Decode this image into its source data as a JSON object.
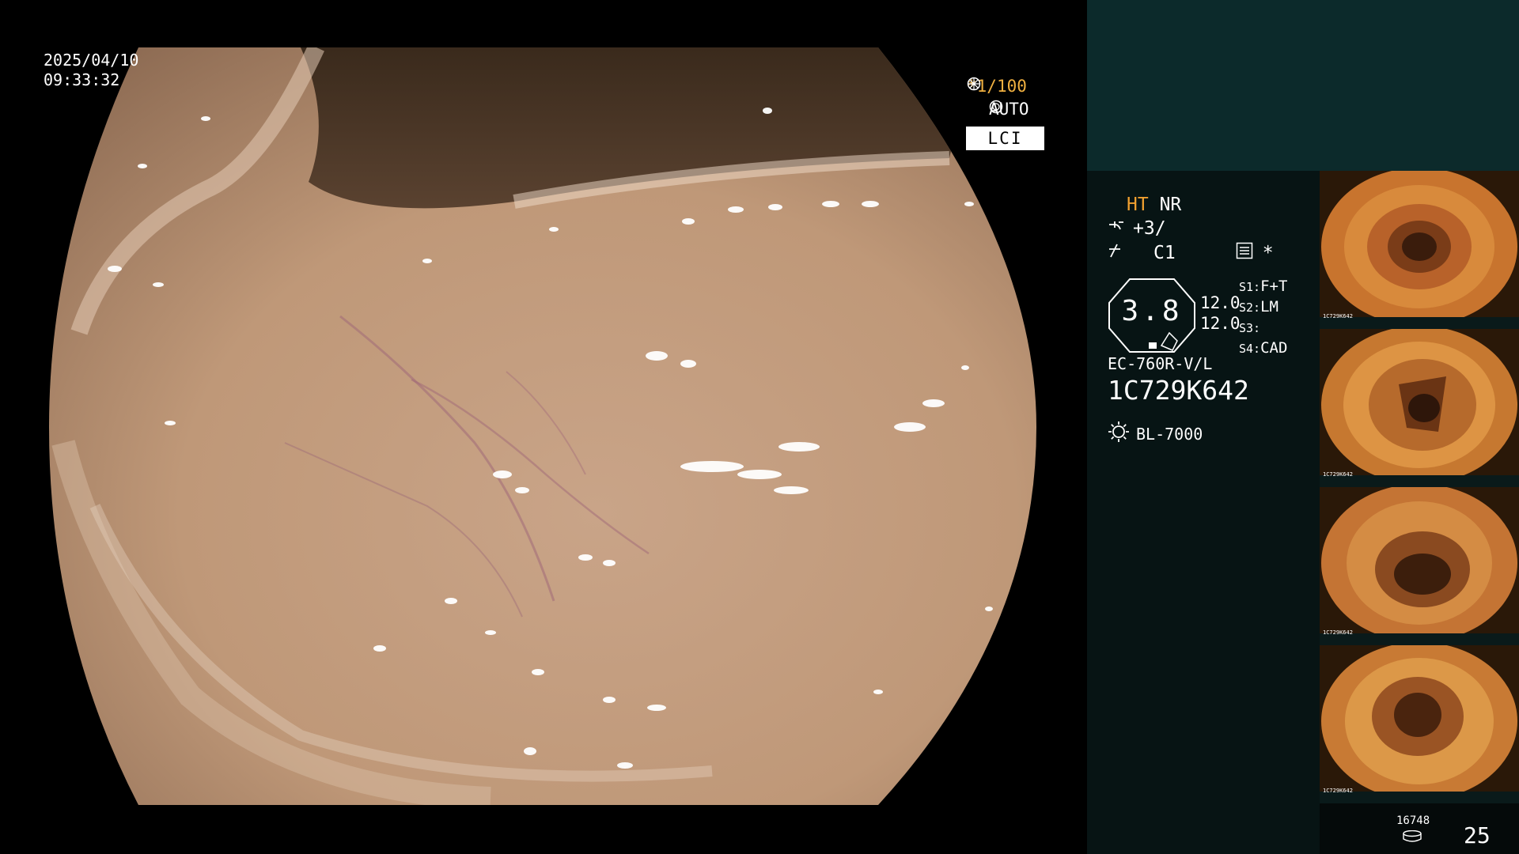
{
  "overlay": {
    "date": "2025/04/10",
    "time": "09:33:32",
    "shutter_star": "*",
    "shutter": "1/100",
    "auto": "AUTO",
    "mode": "LCI",
    "shutter_color": "#f0b040"
  },
  "panel": {
    "ht": "HT",
    "nr": "NR",
    "ht_color": "#f0a030",
    "enhance": "+3/",
    "color_mode": "C1",
    "star": "*",
    "zoom": "3.8",
    "val1": "12.0",
    "val2": "12.0",
    "s1_label": "S1:",
    "s1_value": "F+T",
    "s2_label": "S2:",
    "s2_value": "LM",
    "s3_label": "S3:",
    "s3_value": "",
    "s4_label": "S4:",
    "s4_value": "CAD",
    "scope_model": "EC-760R-V/L",
    "scope_serial": "1C729K642",
    "light_source": "BL-7000",
    "icons": [
      "enhance-icon",
      "color-icon",
      "menu-icon",
      "light-icon",
      "disk-icon"
    ]
  },
  "thumbnails": [
    {
      "id": "thumb-1",
      "serial": "1C729K642"
    },
    {
      "id": "thumb-2",
      "serial": "1C729K642"
    },
    {
      "id": "thumb-3",
      "serial": "1C729K642"
    },
    {
      "id": "thumb-4",
      "serial": "1C729K642"
    }
  ],
  "footer": {
    "counter": "16748",
    "page": "25"
  }
}
